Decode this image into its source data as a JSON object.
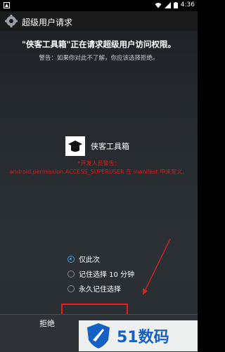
{
  "status_bar": {
    "time": "4:36"
  },
  "title_bar": {
    "title": "超级用户请求"
  },
  "request": {
    "headline": "\"侠客工具箱\"正在请求超级用户访问权限。",
    "warning": "警告：如果你对此不了解，你应该选择拒绝。"
  },
  "app": {
    "name": "侠客工具箱"
  },
  "dev_warning": {
    "line1": "*开发人员警告：",
    "line2": "android.permission.ACCESS_SUPERUSER 在 manifest 中未定义。"
  },
  "options": [
    {
      "label": "仅此次",
      "checked": true
    },
    {
      "label": "记住选择 10 分钟",
      "checked": false
    },
    {
      "label": "永久记住选择",
      "checked": false
    }
  ],
  "buttons": {
    "reject": "拒绝"
  },
  "watermark": {
    "text": "51数码"
  },
  "colors": {
    "accent": "#3aa4e6",
    "warning": "#e01a1a",
    "watermark": "#1560c3"
  }
}
